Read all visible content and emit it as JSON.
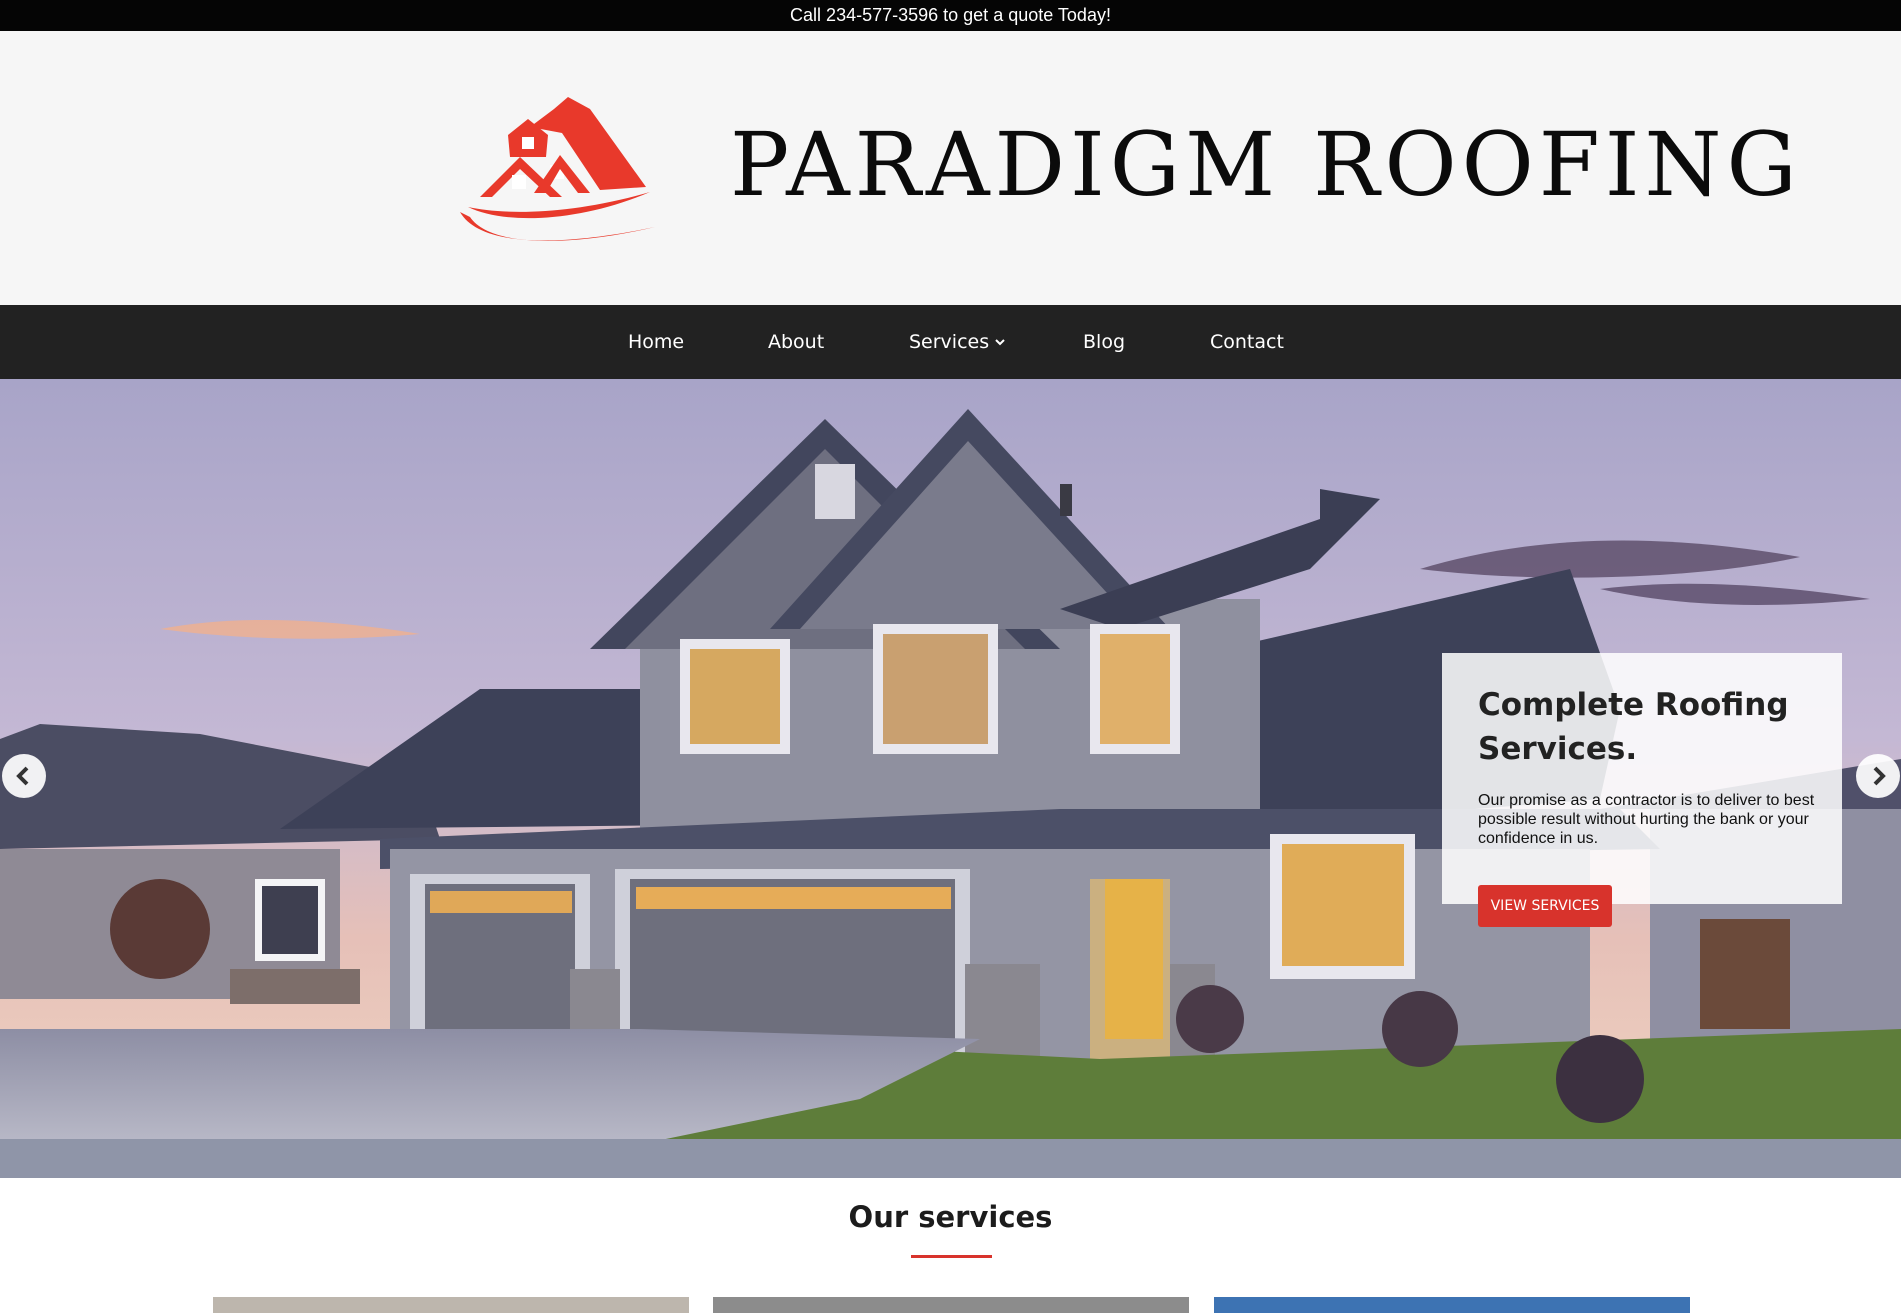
{
  "topbar": {
    "text": "Call 234-577-3596 to get a quote Today!"
  },
  "header": {
    "brand_name": "PARADIGM ROOFING",
    "logo_icon": "house-roof-logo-icon",
    "brand_color": "#e8392b"
  },
  "nav": {
    "items": [
      {
        "label": "Home"
      },
      {
        "label": "About"
      },
      {
        "label": "Services",
        "has_dropdown": true
      },
      {
        "label": "Blog"
      },
      {
        "label": "Contact"
      }
    ]
  },
  "hero": {
    "title": "Complete Roofing Services.",
    "text": "Our promise as a contractor is to deliver to best possible result without hurting the bank or your confidence in us.",
    "button_label": "VIEW SERVICES",
    "prev_icon": "chevron-left-icon",
    "next_icon": "chevron-right-icon"
  },
  "services": {
    "title": "Our services",
    "accent_color": "#d8332c"
  },
  "colors": {
    "topbar_bg": "#050505",
    "header_bg": "#f6f6f6",
    "nav_bg": "#222222",
    "button_bg": "#d8332c"
  }
}
